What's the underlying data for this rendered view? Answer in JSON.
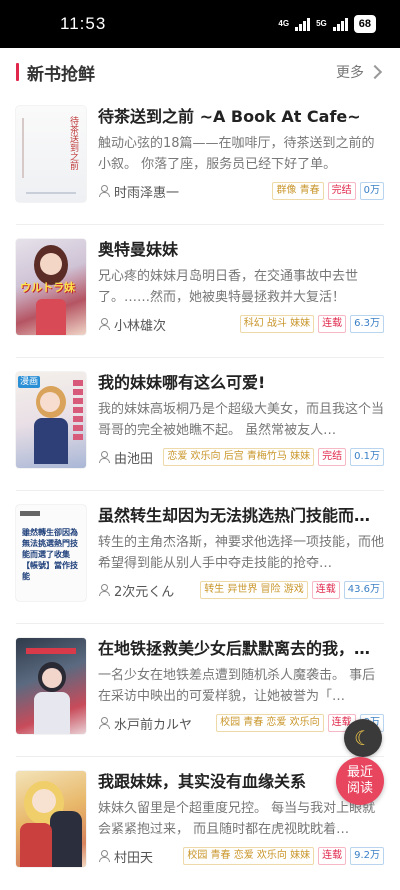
{
  "status_bar": {
    "time": "11:53",
    "net1": "4G",
    "net2": "5G",
    "battery": "68"
  },
  "section": {
    "title": "新书抢鲜",
    "more_label": "更多"
  },
  "books": [
    {
      "title": "待茶送到之前 ~A Book At Cafe~",
      "desc": "触动心弦的18篇——在咖啡厅，待茶送到之前的小叙。 你落了座，服务员已经下好了单。",
      "author": "时雨泽惠一",
      "genres": "群像 青春",
      "status": "完结",
      "count": "0万",
      "cover_text": "待茶送到之前"
    },
    {
      "title": "奥特曼妹妹",
      "desc": "兄心疼的妹妹月岛明日香，在交通事故中去世了。……然而，她被奥特曼拯救并大复活！",
      "author": "小林雄次",
      "genres": "科幻 战斗 妹妹",
      "status": "连载",
      "count": "6.3万",
      "cover_text": "ウルトラ妹"
    },
    {
      "title": "我的妹妹哪有这么可爱!",
      "desc": "我的妹妹高坂桐乃是个超级大美女，而且我这个当哥哥的完全被她瞧不起。 虽然常被友人…",
      "author": "由池田",
      "genres": "恋爱 欢乐向 后宫 青梅竹马 妹妹",
      "status": "完结",
      "count": "0.1万",
      "cover_text": "漫画"
    },
    {
      "title": "虽然转生却因为无法挑选热门技能而…",
      "desc": "转生的主角杰洛斯，神要求他选择一项技能，而他希望得到能从别人手中夺走技能的抢夺…",
      "author": "2次元くん",
      "genres": "转生 异世界 冒险 游戏",
      "status": "连载",
      "count": "43.6万",
      "cover_text": "雖然轉生卻因為無法挑選熱門技能而選了收集【帳號】當作技能"
    },
    {
      "title": "在地铁拯救美少女后默默离去的我，…",
      "desc": "一名少女在地铁差点遭到随机杀人魔袭击。 事后在采访中映出的可爱样貌，让她被誉为「…",
      "author": "水戸前カルヤ",
      "genres": "校园 青春 恋爱 欢乐向",
      "status": "连载",
      "count": "9万",
      "cover_text": ""
    },
    {
      "title": "我跟妹妹，其实没有血缘关系",
      "desc": "妹妹久留里是个超重度兄控。 每当与我对上眼就会紧紧抱过来， 而且随时都在虎视眈眈着…",
      "author": "村田天",
      "genres": "校园 青春 恋爱 欢乐向 妹妹",
      "status": "连载",
      "count": "9.2万",
      "cover_text": ""
    }
  ],
  "float": {
    "moon_icon": "moon-icon",
    "recent_label_1": "最近",
    "recent_label_2": "阅读"
  },
  "colors": {
    "accent": "#e0274b",
    "recent_button": "#e8455f"
  }
}
